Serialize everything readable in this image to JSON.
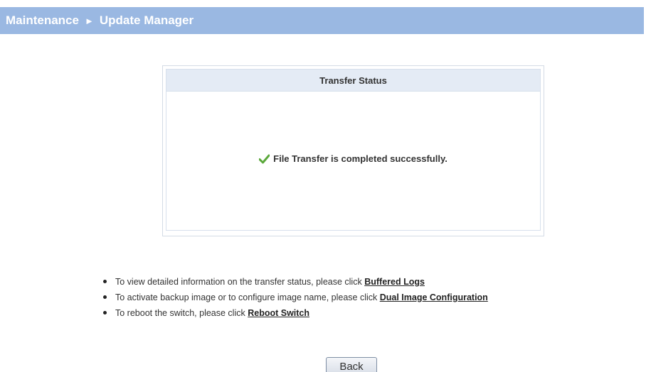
{
  "header": {
    "section": "Maintenance",
    "separator": "►",
    "page": "Update Manager"
  },
  "status_panel": {
    "title": "Transfer Status",
    "icon": "checkmark-icon",
    "message": "File Transfer is completed successfully."
  },
  "help_items": [
    {
      "text": "To view detailed information on the transfer status, please click",
      "link": "Buffered Logs"
    },
    {
      "text": "To activate backup image or to configure image name, please click",
      "link": "Dual Image Configuration"
    },
    {
      "text": "To reboot the switch, please click",
      "link": "Reboot Switch"
    }
  ],
  "back_button": {
    "label": "Back"
  },
  "colors": {
    "header_bg": "#9ab8e2",
    "panel_header_bg": "#e4ebf5",
    "check_green": "#5aa83a"
  }
}
